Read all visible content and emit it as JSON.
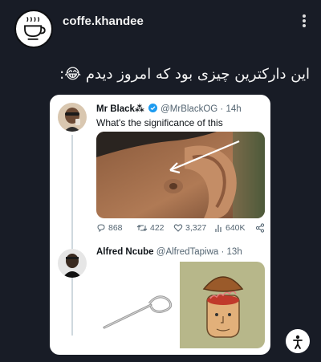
{
  "post": {
    "username": "coffe.khandee",
    "avatar_icon": "coffee-cup-logo-icon",
    "more_icon": "more-vertical-icon",
    "caption": "این دارکترین چیزی بود که امروز دیدم 😂:"
  },
  "tweets": [
    {
      "name": "Mr Black",
      "name_suffix": "⁂",
      "verified": true,
      "handle": "@MrBlackOG",
      "time": "· 14h",
      "text": "What's the significance of this",
      "image_icon": "ear-closeup-photo",
      "stats": {
        "replies": "868",
        "retweets": "422",
        "likes": "3,327",
        "views": "640K"
      }
    },
    {
      "name": "Alfred Ncube",
      "handle": "@AlfredTapiwa",
      "time": "· 13h",
      "images": [
        "sim-ejector-pin-image",
        "head-brain-cartoon-image"
      ]
    }
  ],
  "fab_icon": "accessibility-person-icon",
  "colors": {
    "background": "#181c26",
    "card": "#ffffff",
    "verified": "#1d9bf0",
    "muted": "#536471"
  }
}
